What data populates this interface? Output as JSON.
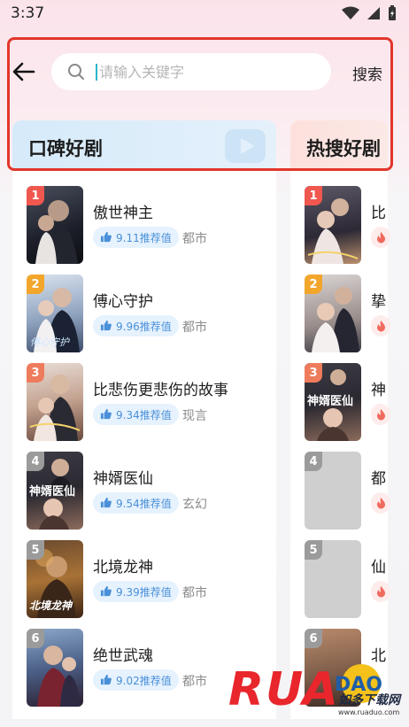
{
  "status_bar": {
    "time": "3:37"
  },
  "search": {
    "placeholder": "请输入关键字",
    "submit_label": "搜索"
  },
  "tabs": [
    {
      "label": "口碑好剧"
    },
    {
      "label": "热搜好剧"
    }
  ],
  "left_list": [
    {
      "rank": "1",
      "title": "傲世神主",
      "score": "9.11推荐值",
      "genre": "都市"
    },
    {
      "rank": "2",
      "title": "傅心守护",
      "score": "9.96推荐值",
      "genre": "都市"
    },
    {
      "rank": "3",
      "title": "比悲伤更悲伤的故事",
      "score": "9.34推荐值",
      "genre": "现言"
    },
    {
      "rank": "4",
      "title": "神婿医仙",
      "score": "9.54推荐值",
      "genre": "玄幻"
    },
    {
      "rank": "5",
      "title": "北境龙神",
      "score": "9.39推荐值",
      "genre": "都市"
    },
    {
      "rank": "6",
      "title": "绝世武魂",
      "score": "9.02推荐值",
      "genre": "都市"
    }
  ],
  "right_list": [
    {
      "rank": "1",
      "title": "比"
    },
    {
      "rank": "2",
      "title": "挚"
    },
    {
      "rank": "3",
      "title": "神"
    },
    {
      "rank": "4",
      "title": "都"
    },
    {
      "rank": "5",
      "title": "仙"
    },
    {
      "rank": "6",
      "title": "北"
    }
  ],
  "cover_texts": {
    "left_2": "傅心守护",
    "left_4": "神婿医仙",
    "left_5": "北境龙神",
    "right_3": "神婿医仙"
  },
  "watermark": {
    "brand": "RUANDAO",
    "cn": "如多下载网",
    "url": "www.ruaduo.com"
  },
  "colors": {
    "highlight": "#e2362b",
    "score_text": "#4a90d9",
    "rank_1": "#f0574f",
    "rank_2": "#f2a62c",
    "rank_3": "#ee7c5c",
    "rank_other": "#9b9b9b"
  }
}
